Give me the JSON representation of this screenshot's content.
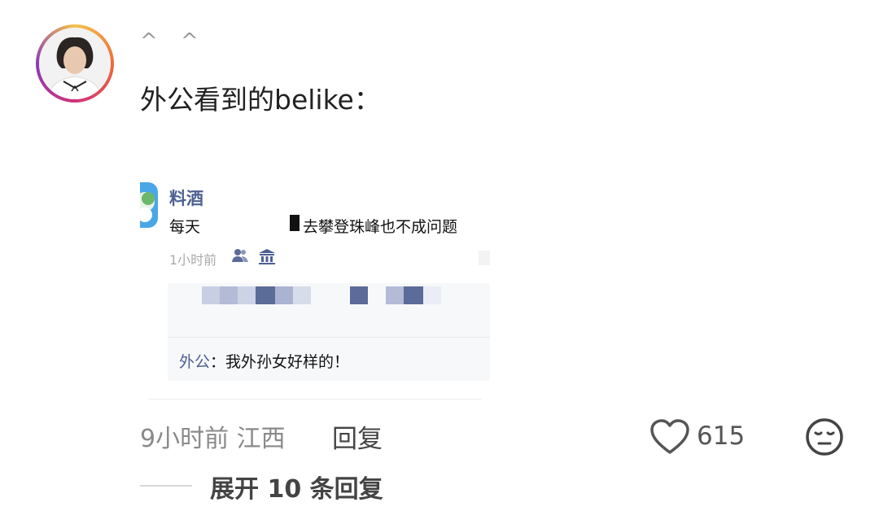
{
  "comment": {
    "username": "^ ^",
    "text": "外公看到的belike：",
    "meta": "9小时前 江西",
    "reply_label": "回复",
    "like_count": "615",
    "expand_label": "展开 10 条回复"
  },
  "embedded_post": {
    "author": "料酒",
    "text_left": "每天",
    "text_right": "去攀登珠峰也不成问题",
    "time": "1小时前",
    "reply_author": "外公",
    "reply_sep": "：",
    "reply_text": "我外孙女好样的！"
  },
  "icons": {
    "like": "heart-outline-icon",
    "emoji": "neutral-face-icon",
    "people": "people-icon",
    "temple": "temple-icon"
  }
}
